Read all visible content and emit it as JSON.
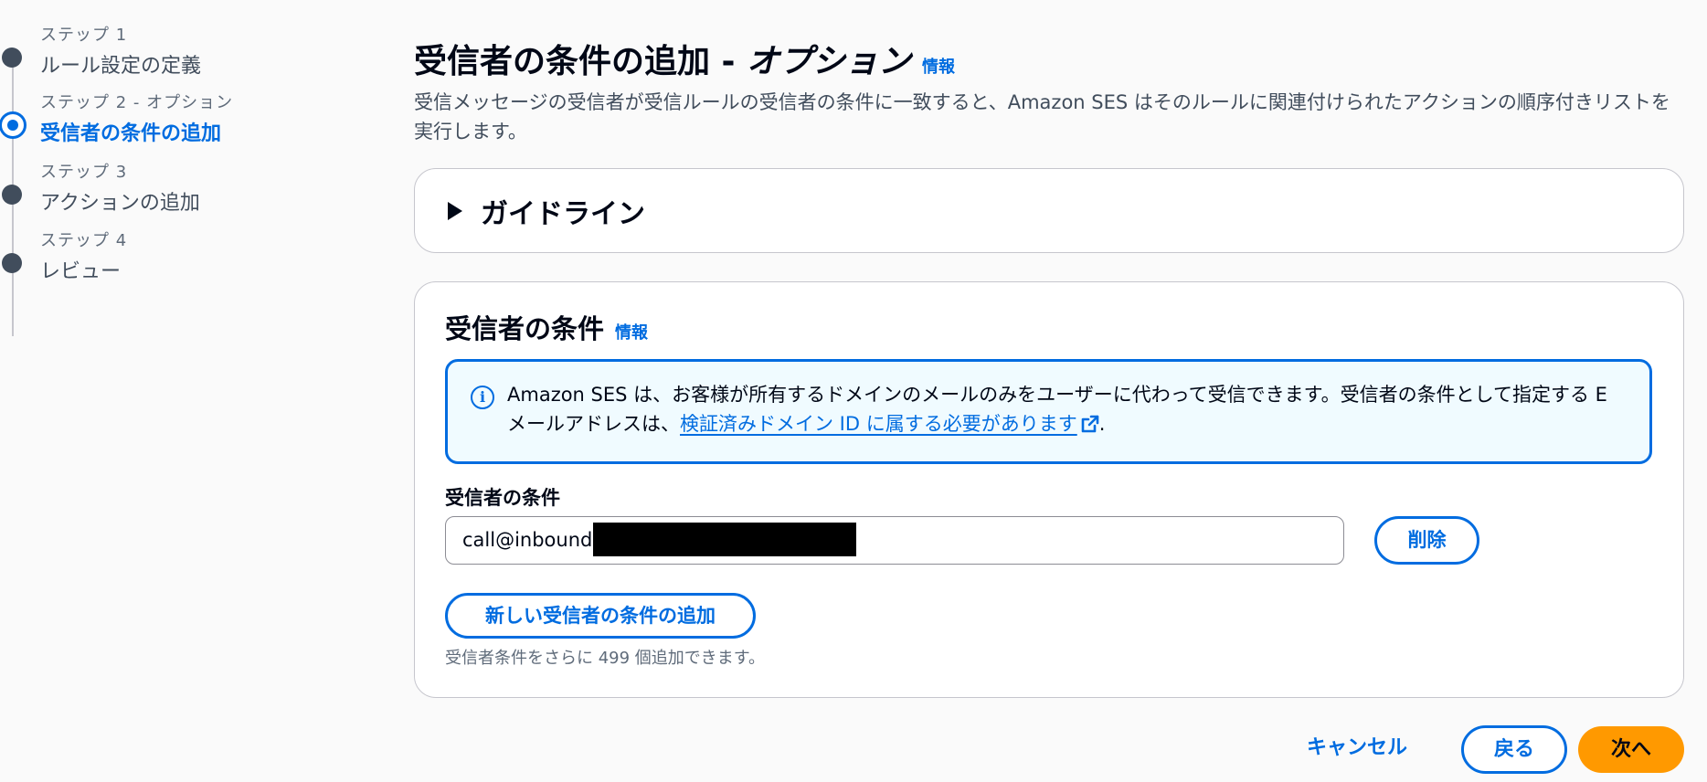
{
  "stepper": {
    "steps": [
      {
        "number": "ステップ 1",
        "title": "ルール設定の定義",
        "state": "completed"
      },
      {
        "number": "ステップ 2 - オプション",
        "title": "受信者の条件の追加",
        "state": "current"
      },
      {
        "number": "ステップ 3",
        "title": "アクションの追加",
        "state": "upcoming"
      },
      {
        "number": "ステップ 4",
        "title": "レビュー",
        "state": "upcoming"
      }
    ]
  },
  "header": {
    "title": "受信者の条件の追加 - ",
    "title_italic": "オプション",
    "info_label": "情報",
    "description": "受信メッセージの受信者が受信ルールの受信者の条件に一致すると、Amazon SES はそのルールに関連付けられたアクションの順序付きリストを実行します。"
  },
  "guidelines": {
    "title": "ガイドライン",
    "expanded": false
  },
  "recipient_conditions": {
    "title": "受信者の条件",
    "info_label": "情報",
    "alert": {
      "text_before": "Amazon SES は、お客様が所有するドメインのメールのみをユーザーに代わって受信できます。受信者の条件として指定する E メールアドレスは、",
      "link_text": "検証済みドメイン ID に属する必要があります",
      "text_after": "."
    },
    "field_label": "受信者の条件",
    "input_value": "call@inbound.",
    "delete_label": "削除",
    "add_label": "新しい受信者の条件の追加",
    "hint": "受信者条件をさらに 499 個追加できます。"
  },
  "footer": {
    "cancel_label": "キャンセル",
    "back_label": "戻る",
    "next_label": "次へ"
  },
  "colors": {
    "accent": "#006ce0",
    "primary_button": "#ff9900",
    "alert_background": "#f0fbff"
  }
}
